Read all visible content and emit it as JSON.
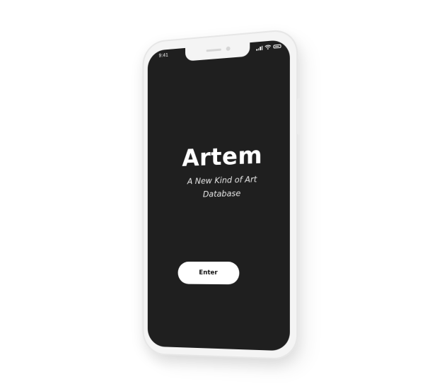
{
  "status_bar": {
    "time": "9:41",
    "icons": [
      "cellular-signal-icon",
      "wifi-icon",
      "battery-icon"
    ]
  },
  "app": {
    "title": "Artem",
    "subtitle": "A New Kind of Art Database"
  },
  "actions": {
    "enter_label": "Enter"
  },
  "colors": {
    "screen_background": "#1f1f1f",
    "text_primary": "#ffffff",
    "button_background": "#ffffff",
    "button_text": "#111111",
    "device_frame": "#f4f4f4"
  }
}
